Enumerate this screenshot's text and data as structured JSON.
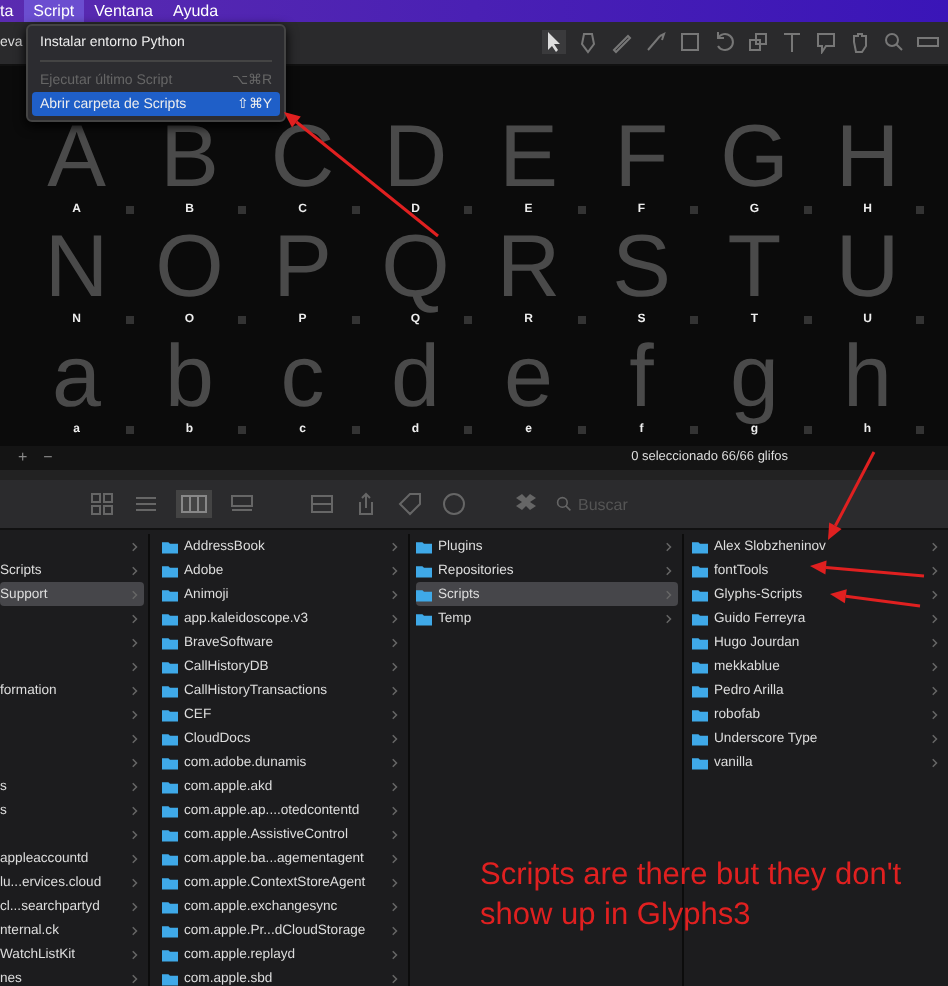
{
  "menu_bar": {
    "items": [
      {
        "label": "ta",
        "selected": false
      },
      {
        "label": "Script",
        "selected": true
      },
      {
        "label": "Ventana",
        "selected": false
      },
      {
        "label": "Ayuda",
        "selected": false
      }
    ]
  },
  "script_menu": {
    "items": [
      {
        "kind": "item",
        "label": "Instalar entorno Python",
        "disabled": false,
        "selected": false
      },
      {
        "kind": "separator"
      },
      {
        "kind": "item",
        "label": "Ejecutar último Script",
        "shortcut": "⌥⌘R",
        "disabled": true,
        "selected": false
      },
      {
        "kind": "item",
        "label": "Abrir carpeta de Scripts",
        "shortcut": "⇧⌘Y",
        "disabled": false,
        "selected": true
      }
    ]
  },
  "glyphs_window": {
    "title": "eva",
    "glyphs": [
      {
        "glyph": "A",
        "label": "A"
      },
      {
        "glyph": "B",
        "label": "B"
      },
      {
        "glyph": "C",
        "label": "C"
      },
      {
        "glyph": "D",
        "label": "D"
      },
      {
        "glyph": "E",
        "label": "E"
      },
      {
        "glyph": "F",
        "label": "F"
      },
      {
        "glyph": "G",
        "label": "G"
      },
      {
        "glyph": "H",
        "label": "H"
      },
      {
        "glyph": "N",
        "label": "N"
      },
      {
        "glyph": "O",
        "label": "O"
      },
      {
        "glyph": "P",
        "label": "P"
      },
      {
        "glyph": "Q",
        "label": "Q"
      },
      {
        "glyph": "R",
        "label": "R"
      },
      {
        "glyph": "S",
        "label": "S"
      },
      {
        "glyph": "T",
        "label": "T"
      },
      {
        "glyph": "U",
        "label": "U"
      },
      {
        "glyph": "a",
        "label": "a"
      },
      {
        "glyph": "b",
        "label": "b"
      },
      {
        "glyph": "c",
        "label": "c"
      },
      {
        "glyph": "d",
        "label": "d"
      },
      {
        "glyph": "e",
        "label": "e"
      },
      {
        "glyph": "f",
        "label": "f"
      },
      {
        "glyph": "g",
        "label": "g"
      },
      {
        "glyph": "h",
        "label": "h"
      }
    ],
    "add_label": "+",
    "remove_label": "−",
    "status": "0 seleccionado 66/66 glifos"
  },
  "finder": {
    "search": {
      "placeholder": "Buscar"
    },
    "columns": [
      {
        "items": [
          {
            "selected": false
          },
          {
            "name": "Scripts",
            "selected": false
          },
          {
            "name": "Support",
            "selected": true
          },
          {
            "selected": false
          },
          {
            "selected": false
          },
          {
            "selected": false
          },
          {
            "name": "formation",
            "selected": false
          },
          {
            "selected": false
          },
          {
            "selected": false
          },
          {
            "selected": false
          },
          {
            "name": "s",
            "selected": false
          },
          {
            "name": "s",
            "selected": false
          },
          {
            "selected": false
          },
          {
            "name": "appleaccountd",
            "selected": false
          },
          {
            "name": "lu...ervices.cloud",
            "selected": false
          },
          {
            "name": "cl...searchpartyd",
            "selected": false
          },
          {
            "name": "nternal.ck",
            "selected": false
          },
          {
            "name": "WatchListKit",
            "selected": false
          },
          {
            "name": "nes",
            "selected": false
          }
        ]
      },
      {
        "items": [
          {
            "name": "AddressBook",
            "selected": false
          },
          {
            "name": "Adobe",
            "selected": false
          },
          {
            "name": "Animoji",
            "selected": false
          },
          {
            "name": "app.kaleidoscope.v3",
            "selected": false
          },
          {
            "name": "BraveSoftware",
            "selected": false
          },
          {
            "name": "CallHistoryDB",
            "selected": false
          },
          {
            "name": "CallHistoryTransactions",
            "selected": false
          },
          {
            "name": "CEF",
            "selected": false
          },
          {
            "name": "CloudDocs",
            "selected": false
          },
          {
            "name": "com.adobe.dunamis",
            "selected": false
          },
          {
            "name": "com.apple.akd",
            "selected": false
          },
          {
            "name": "com.apple.ap....otedcontentd",
            "selected": false
          },
          {
            "name": "com.apple.AssistiveControl",
            "selected": false
          },
          {
            "name": "com.apple.ba...agementagent",
            "selected": false
          },
          {
            "name": "com.apple.ContextStoreAgent",
            "selected": false
          },
          {
            "name": "com.apple.exchangesync",
            "selected": false
          },
          {
            "name": "com.apple.Pr...dCloudStorage",
            "selected": false
          },
          {
            "name": "com.apple.replayd",
            "selected": false
          },
          {
            "name": "com.apple.sbd",
            "selected": false
          }
        ]
      },
      {
        "items": [
          {
            "name": "Plugins",
            "selected": false
          },
          {
            "name": "Repositories",
            "selected": false
          },
          {
            "name": "Scripts",
            "selected": true
          },
          {
            "name": "Temp",
            "selected": false
          }
        ]
      },
      {
        "items": [
          {
            "name": "Alex Slobzheninov",
            "selected": false
          },
          {
            "name": "fontTools",
            "selected": false
          },
          {
            "name": "Glyphs-Scripts",
            "selected": false
          },
          {
            "name": "Guido Ferreyra",
            "selected": false
          },
          {
            "name": "Hugo Jourdan",
            "selected": false
          },
          {
            "name": "mekkablue",
            "selected": false
          },
          {
            "name": "Pedro Arilla",
            "selected": false
          },
          {
            "name": "robofab",
            "selected": false
          },
          {
            "name": "Underscore Type",
            "selected": false
          },
          {
            "name": "vanilla",
            "selected": false
          }
        ]
      }
    ]
  },
  "annotation": {
    "text": "Scripts are there but they don't show up in Glyphs3"
  }
}
